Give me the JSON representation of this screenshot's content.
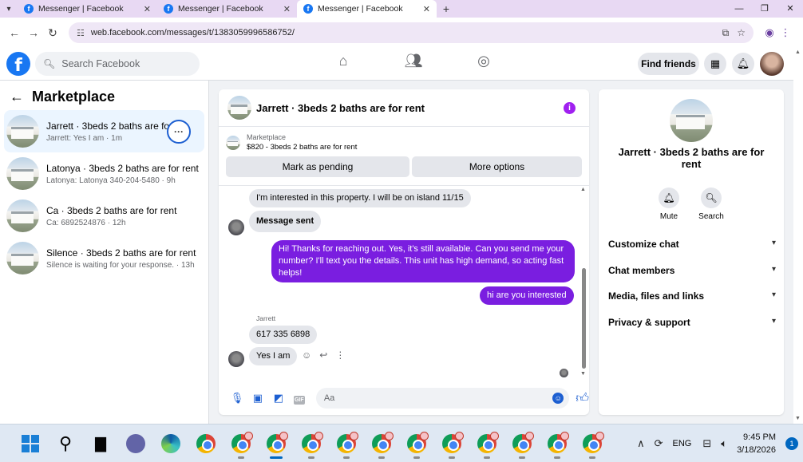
{
  "browser": {
    "tabs": [
      {
        "title": "Messenger | Facebook",
        "active": false
      },
      {
        "title": "Messenger | Facebook",
        "active": false
      },
      {
        "title": "Messenger | Facebook",
        "active": true
      }
    ],
    "url": "web.facebook.com/messages/t/1383059996586752/"
  },
  "fbnav": {
    "search_placeholder": "Search Facebook",
    "find_friends": "Find friends"
  },
  "sidebar": {
    "title": "Marketplace",
    "conversations": [
      {
        "name": "Jarrett · 3beds 2 baths are for",
        "preview": "Jarrett: Yes I am · 1m",
        "selected": true
      },
      {
        "name": "Latonya · 3beds 2 baths are for rent",
        "preview": "Latonya: Latonya 340-204-5480 · 9h",
        "selected": false
      },
      {
        "name": "Ca · 3beds 2 baths are for rent",
        "preview": "Ca: 6892524876 · 12h",
        "selected": false
      },
      {
        "name": "Silence · 3beds 2 baths are for rent",
        "preview": "Silence is waiting for your response. · 13h",
        "selected": false
      }
    ]
  },
  "chat": {
    "title": "Jarrett · 3beds 2 baths are for rent",
    "marketplace_label": "Marketplace",
    "listing": "$820 - 3beds 2 baths are for rent",
    "mark_pending": "Mark as pending",
    "more_options": "More options",
    "messages": {
      "m1": "I'm interested in this property. I will be on island 11/15",
      "m2": "Message sent",
      "m3": "Hi! Thanks for reaching out. Yes, it's still available. Can you send me your number? I'll text you the details. This unit has high demand, so acting fast helps!",
      "m4": "hi are you interested",
      "sender": "Jarrett",
      "m5": "617 335 6898",
      "m6": "Yes I am"
    },
    "composer_placeholder": "Aa",
    "accent": "#7a1ee0"
  },
  "details": {
    "name": "Jarrett · 3beds 2 baths are for rent",
    "mute": "Mute",
    "search": "Search",
    "sections": [
      "Customize chat",
      "Chat members",
      "Media, files and links",
      "Privacy & support"
    ]
  },
  "taskbar": {
    "lang": "ENG",
    "time": "9:45 PM",
    "date": "3/18/2026",
    "notifications": "1"
  }
}
